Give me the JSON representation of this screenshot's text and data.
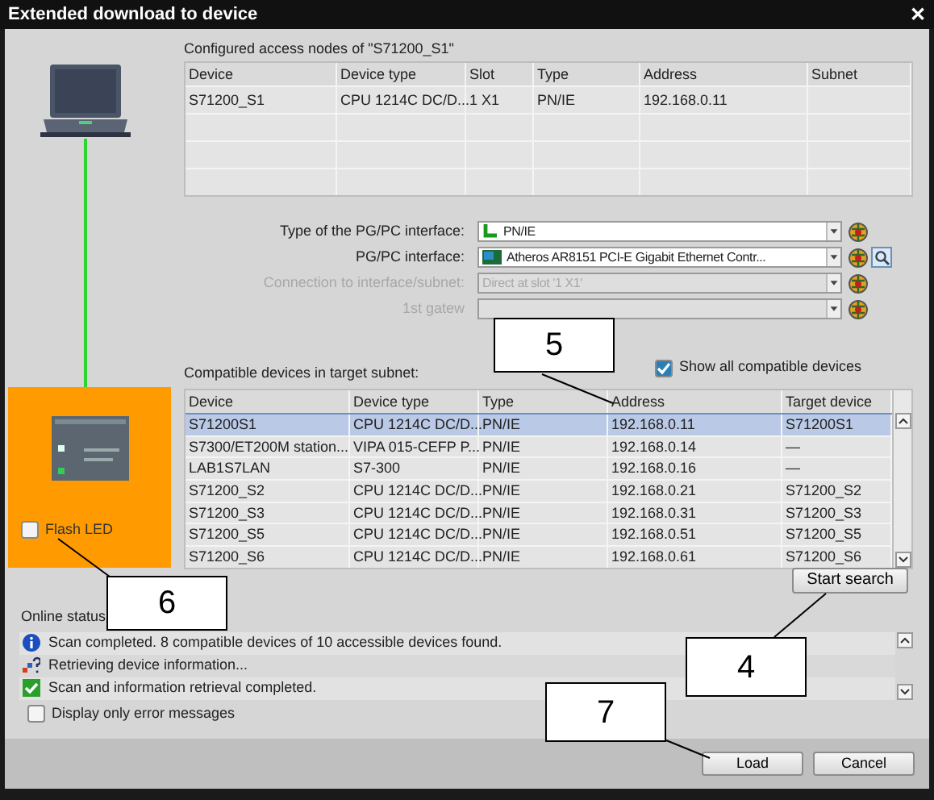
{
  "window": {
    "title": "Extended download to device",
    "close": "✕"
  },
  "configured": {
    "title": "Configured access nodes of \"S71200_S1\"",
    "columns": [
      "Device",
      "Device type",
      "Slot",
      "Type",
      "Address",
      "Subnet"
    ],
    "rows": [
      [
        "S71200_S1",
        "CPU 1214C DC/D...",
        "1 X1",
        "PN/IE",
        "192.168.0.11",
        ""
      ]
    ]
  },
  "interface": [
    {
      "label": "Type of the PG/PC interface:",
      "value": "PN/IE",
      "disabled": false,
      "search": false
    },
    {
      "label": "PG/PC interface:",
      "value": "Atheros AR8151 PCI-E Gigabit Ethernet Contr...",
      "disabled": false,
      "search": true
    },
    {
      "label": "Connection to interface/subnet:",
      "value": "Direct at slot '1 X1'",
      "disabled": true,
      "search": false
    },
    {
      "label": "1st gatew",
      "disabled": true,
      "search": false
    }
  ],
  "compatible": {
    "title": "Compatible devices in target subnet:",
    "show_all": {
      "label": "Show all compatible devices",
      "checked": true
    },
    "columns": [
      "Device",
      "Device type",
      "Type",
      "Address",
      "Target device"
    ],
    "rows": [
      {
        "cells": [
          "S71200S1",
          "CPU 1214C DC/D...",
          "PN/IE",
          "192.168.0.11",
          "S71200S1"
        ],
        "selected": true
      },
      {
        "cells": [
          "S7300/ET200M station...",
          "VIPA 015-CEFP  P...",
          "PN/IE",
          "192.168.0.14",
          "—"
        ],
        "selected": false
      },
      {
        "cells": [
          "LAB1S7LAN",
          "S7-300",
          "PN/IE",
          "192.168.0.16",
          "—"
        ],
        "selected": false
      },
      {
        "cells": [
          "S71200_S2",
          "CPU 1214C DC/D...",
          "PN/IE",
          "192.168.0.21",
          "S71200_S2"
        ],
        "selected": false
      },
      {
        "cells": [
          "S71200_S3",
          "CPU 1214C DC/D...",
          "PN/IE",
          "192.168.0.31",
          "S71200_S3"
        ],
        "selected": false
      },
      {
        "cells": [
          "S71200_S5",
          "CPU 1214C DC/D...",
          "PN/IE",
          "192.168.0.51",
          "S71200_S5"
        ],
        "selected": false
      },
      {
        "cells": [
          "S71200_S6",
          "CPU 1214C DC/D...",
          "PN/IE",
          "192.168.0.61",
          "S71200_S6"
        ],
        "selected": false
      }
    ]
  },
  "flash_led": {
    "label": "Flash LED",
    "checked": false
  },
  "start_search": "Start search",
  "online_status": {
    "title": "Online status",
    "messages": [
      {
        "kind": "info",
        "text": "Scan completed. 8 compatible devices of 10 accessible devices found."
      },
      {
        "kind": "busy",
        "text": "Retrieving device information..."
      },
      {
        "kind": "ok",
        "text": "Scan and information retrieval completed."
      }
    ],
    "errors_only": {
      "label": "Display only error messages",
      "checked": false
    }
  },
  "buttons": [
    "Load",
    "Cancel"
  ],
  "callouts": [
    {
      "label": "5"
    },
    {
      "label": "6"
    },
    {
      "label": "4"
    },
    {
      "label": "7"
    }
  ]
}
